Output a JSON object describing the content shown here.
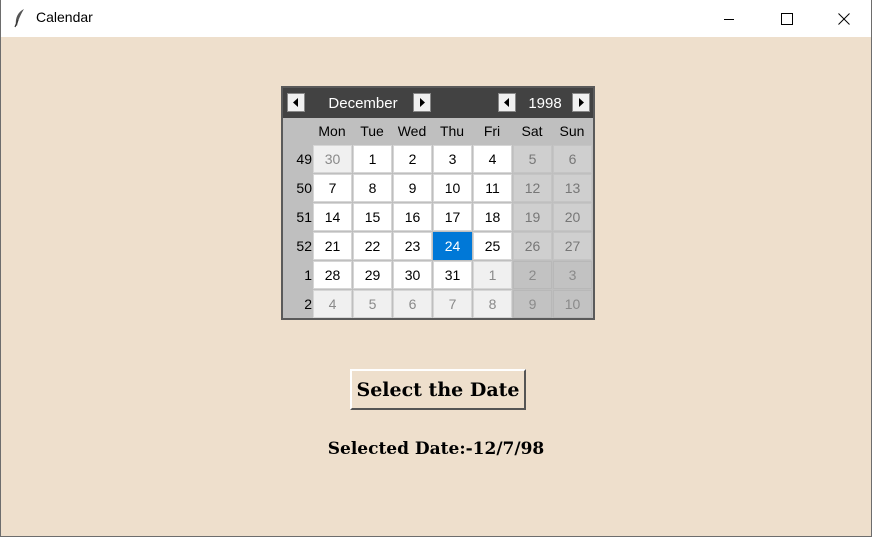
{
  "window": {
    "title": "Calendar",
    "icon": "feather-icon"
  },
  "calendar": {
    "month": "December",
    "year": "1998",
    "days_of_week": [
      "Mon",
      "Tue",
      "Wed",
      "Thu",
      "Fri",
      "Sat",
      "Sun"
    ],
    "weeks": [
      {
        "week": "49",
        "days": [
          "30",
          "1",
          "2",
          "3",
          "4",
          "5",
          "6"
        ]
      },
      {
        "week": "50",
        "days": [
          "7",
          "8",
          "9",
          "10",
          "11",
          "12",
          "13"
        ]
      },
      {
        "week": "51",
        "days": [
          "14",
          "15",
          "16",
          "17",
          "18",
          "19",
          "20"
        ]
      },
      {
        "week": "52",
        "days": [
          "21",
          "22",
          "23",
          "24",
          "25",
          "26",
          "27"
        ]
      },
      {
        "week": "1",
        "days": [
          "28",
          "29",
          "30",
          "31",
          "1",
          "2",
          "3"
        ]
      },
      {
        "week": "2",
        "days": [
          "4",
          "5",
          "6",
          "7",
          "8",
          "9",
          "10"
        ]
      }
    ],
    "selected_day": "24",
    "colors": {
      "header": "#424242",
      "selected": "#0078D7",
      "weekend": "#cfcfcf"
    }
  },
  "select_button": {
    "label": "Select the Date"
  },
  "selected_label": "Selected Date:-12/7/98",
  "colors": {
    "background": "#EEDFCC"
  }
}
